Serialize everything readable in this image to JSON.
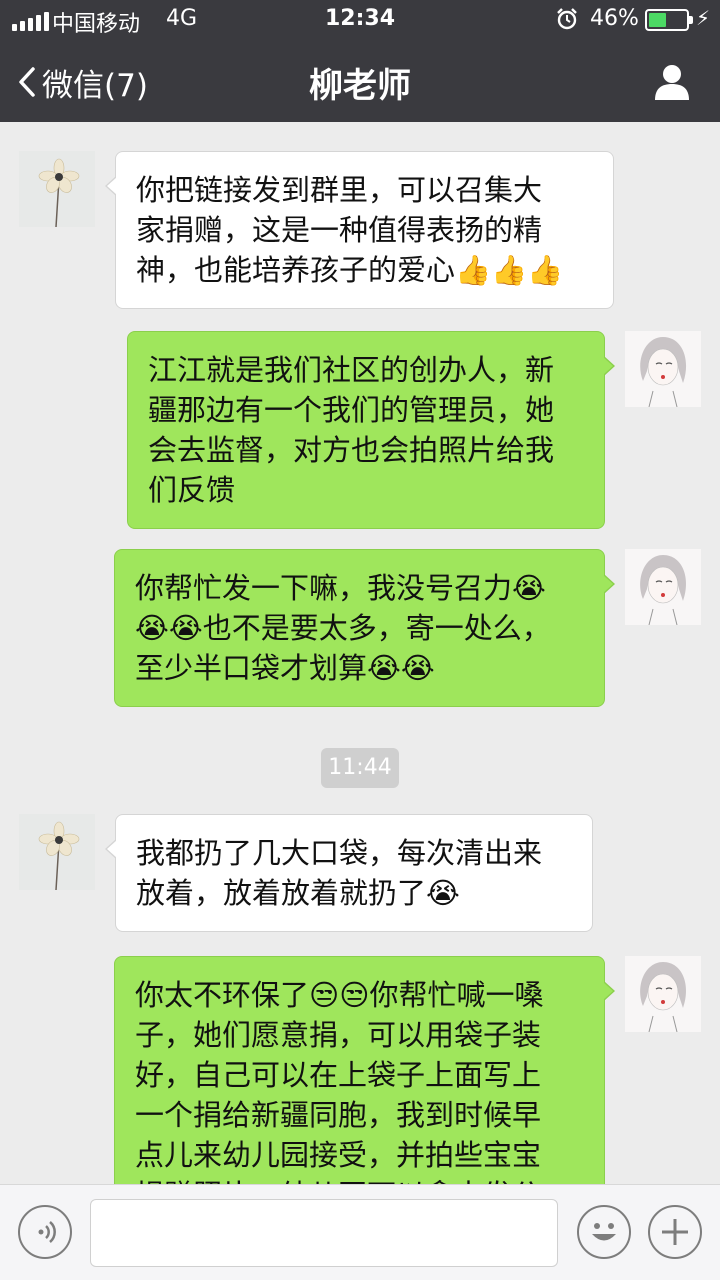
{
  "status_bar": {
    "carrier": "中国移动",
    "network": "4G",
    "time": "12:34",
    "battery": "46%",
    "battery_level": 0.46
  },
  "nav": {
    "back_label": "微信(7)",
    "title": "柳老师"
  },
  "messages": [
    {
      "side": "in",
      "avatar": "flower-avatar",
      "text": "你把链接发到群里，可以召集大\n家捐赠，这是一种值得表扬的精\n神，也能培养孩子的爱心👍👍👍"
    },
    {
      "side": "out",
      "avatar": "girl-avatar",
      "text": "江江就是我们社区的创办人，新\n疆那边有一个我们的管理员，她\n会去监督，对方也会拍照片给我\n们反馈"
    },
    {
      "side": "out",
      "avatar": "girl-avatar",
      "text": "你帮忙发一下嘛，我没号召力😭\n😭😭也不是要太多，寄一处么，\n至少半口袋才划算😭😭"
    },
    {
      "side": "in",
      "avatar": "flower-avatar",
      "text": "我都扔了几大口袋，每次清出来\n放着，放着放着就扔了😭"
    },
    {
      "side": "out",
      "avatar": "girl-avatar",
      "text": "你太不环保了😒😒你帮忙喊一嗓\n子，她们愿意捐，可以用袋子装\n好，自己可以在上袋子上面写上\n一个捐给新疆同胞，我到时候早\n点儿来幼儿园接受，并拍些宝宝\n捐赠照片，幼儿园可以拿去发公"
    }
  ],
  "timestamp": "11:44",
  "input": {
    "value": ""
  },
  "colors": {
    "nav_bg": "#3a3a3f",
    "chat_bg": "#ececec",
    "outgoing_bubble": "#9fe65c",
    "incoming_bubble": "#ffffff",
    "battery_green": "#4cd964"
  }
}
